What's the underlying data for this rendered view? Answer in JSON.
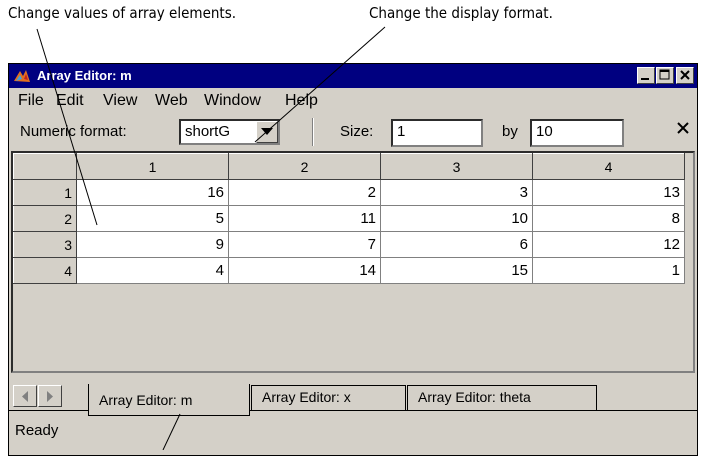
{
  "callouts": {
    "values": "Change values of array elements.",
    "format": "Change the display format."
  },
  "window": {
    "title": "Array Editor: m",
    "icon": "matlab-logo-icon"
  },
  "menu": [
    "File",
    "Edit",
    "View",
    "Web",
    "Window",
    "Help"
  ],
  "toolbar": {
    "numeric_format_label": "Numeric format:",
    "numeric_format_value": "shortG",
    "size_label": "Size:",
    "rows": "1",
    "by_label": "by",
    "cols": "10"
  },
  "grid": {
    "columns": [
      "1",
      "2",
      "3",
      "4"
    ],
    "row_headers": [
      "1",
      "2",
      "3",
      "4"
    ],
    "rows": [
      [
        "16",
        "2",
        "3",
        "13"
      ],
      [
        "5",
        "11",
        "10",
        "8"
      ],
      [
        "9",
        "7",
        "6",
        "12"
      ],
      [
        "4",
        "14",
        "15",
        "1"
      ]
    ]
  },
  "tabs": [
    "Array Editor: m",
    "Array Editor: x",
    "Array Editor: theta"
  ],
  "status": "Ready",
  "colors": {
    "titlebar": "#000080",
    "chrome": "#d4d0c8"
  }
}
